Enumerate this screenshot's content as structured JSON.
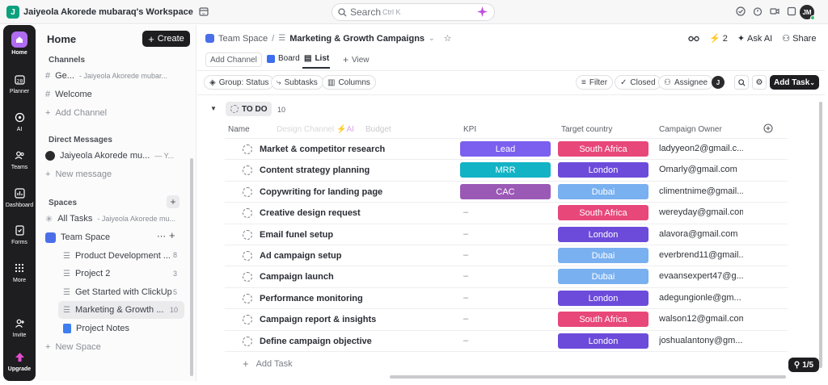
{
  "topbar": {
    "workspace_badge": "J",
    "workspace_name": "Jaiyeola Akorede mubaraq's Workspace",
    "search_label": "Search",
    "search_shortcut": "Ctrl K",
    "avatar_initials": "JM"
  },
  "rail": {
    "items": [
      {
        "label": "Home",
        "icon": "home-icon"
      },
      {
        "label": "Planner",
        "icon": "calendar-icon"
      },
      {
        "label": "AI",
        "icon": "ai-icon"
      },
      {
        "label": "Teams",
        "icon": "teams-icon"
      },
      {
        "label": "Dashboard",
        "icon": "dashboard-icon"
      },
      {
        "label": "Forms",
        "icon": "forms-icon"
      },
      {
        "label": "More",
        "icon": "grid-icon"
      },
      {
        "label": "Invite",
        "icon": "invite-icon"
      },
      {
        "label": "Upgrade",
        "icon": "upgrade-icon"
      }
    ]
  },
  "sidebar": {
    "title": "Home",
    "create_label": "Create",
    "channels_header": "Channels",
    "channel_general": "Ge...",
    "channel_general_sub": "- Jaiyeola Akorede mubar...",
    "channel_welcome": "Welcome",
    "add_channel": "Add Channel",
    "dm_header": "Direct Messages",
    "dm_user": "Jaiyeola Akorede mu...",
    "dm_you": "— Y...",
    "new_message": "New message",
    "spaces_header": "Spaces",
    "all_tasks": "All Tasks",
    "all_tasks_sub": "- Jaiyeola Akorede mu...",
    "team_space": "Team Space",
    "lists": [
      {
        "label": "Product Development ...",
        "count": "8"
      },
      {
        "label": "Project 2",
        "count": "3"
      },
      {
        "label": "Get Started with ClickUp",
        "count": "5"
      },
      {
        "label": "Marketing & Growth ...",
        "count": "10"
      }
    ],
    "project_notes": "Project Notes",
    "new_space": "New Space"
  },
  "header": {
    "breadcrumb_space": "Team Space",
    "breadcrumb_list": "Marketing & Growth Campaigns",
    "agents_count": "2",
    "ask_ai": "Ask AI",
    "share": "Share"
  },
  "views": {
    "add_channel": "Add Channel",
    "board": "Board",
    "list": "List",
    "add_view": "View"
  },
  "toolbar": {
    "group": "Group: Status",
    "subtasks": "Subtasks",
    "columns": "Columns",
    "filter": "Filter",
    "closed": "Closed",
    "assignee": "Assignee",
    "assignee_avatar": "J",
    "add_task": "Add Task"
  },
  "group": {
    "status": "TO DO",
    "count": "10"
  },
  "table": {
    "columns": {
      "name": "Name",
      "ghost": "Design Channel",
      "ai": "AI",
      "budget": "Budget",
      "kpi": "KPI",
      "country": "Target country",
      "owner": "Campaign Owner"
    },
    "rows": [
      {
        "name": "Market & competitor research",
        "kpi": "Lead",
        "kpi_color": "#7b5fef",
        "country": "South Africa",
        "country_color": "#e8477a",
        "owner": "ladyyeon2@gmail.c..."
      },
      {
        "name": "Content strategy planning",
        "kpi": "MRR",
        "kpi_color": "#12b3c5",
        "country": "London",
        "country_color": "#6c4bdb",
        "owner": "Omarly@gmail.com"
      },
      {
        "name": "Copywriting for landing page",
        "kpi": "CAC",
        "kpi_color": "#9b59b6",
        "country": "Dubai",
        "country_color": "#79b0f0",
        "owner": "climentnime@gmail..."
      },
      {
        "name": "Creative design request",
        "kpi": "–",
        "kpi_color": "",
        "country": "South Africa",
        "country_color": "#e8477a",
        "owner": "wereyday@gmail.com"
      },
      {
        "name": "Email funel setup",
        "kpi": "–",
        "kpi_color": "",
        "country": "London",
        "country_color": "#6c4bdb",
        "owner": "alavora@gmail.com"
      },
      {
        "name": "Ad campaign setup",
        "kpi": "–",
        "kpi_color": "",
        "country": "Dubai",
        "country_color": "#79b0f0",
        "owner": "everbrend11@gmail..."
      },
      {
        "name": "Campaign launch",
        "kpi": "–",
        "kpi_color": "",
        "country": "Dubai",
        "country_color": "#79b0f0",
        "owner": "evaansexpert47@g..."
      },
      {
        "name": "Performance monitoring",
        "kpi": "–",
        "kpi_color": "",
        "country": "London",
        "country_color": "#6c4bdb",
        "owner": "adegungionle@gm..."
      },
      {
        "name": "Campaign report & insights",
        "kpi": "–",
        "kpi_color": "",
        "country": "South Africa",
        "country_color": "#e8477a",
        "owner": "walson12@gmail.com"
      },
      {
        "name": "Define campaign objective",
        "kpi": "–",
        "kpi_color": "",
        "country": "London",
        "country_color": "#6c4bdb",
        "owner": "joshualantony@gm..."
      }
    ],
    "add_task": "Add Task"
  },
  "footer": {
    "progress": "1/5"
  }
}
